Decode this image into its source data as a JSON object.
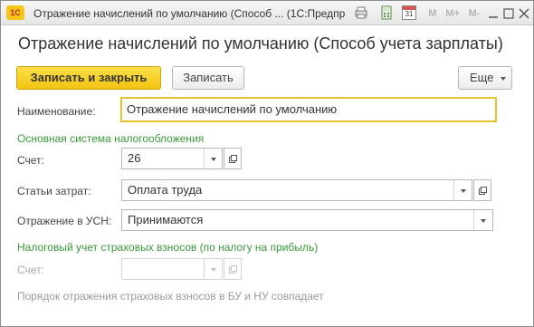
{
  "window": {
    "app_logo_text": "1С",
    "title": "Отражение начислений по умолчанию (Способ ... (1С:Предприятие)",
    "toolbar": {
      "m_label": "M",
      "m_plus_label": "M+",
      "m_minus_label": "M-",
      "calendar_day": "31",
      "icons": [
        "printer-icon",
        "calculator-icon",
        "calendar-icon",
        "minimize-icon",
        "maximize-icon",
        "close-icon"
      ]
    }
  },
  "form": {
    "header": "Отражение начислений по умолчанию (Способ учета зарплаты)",
    "buttons": {
      "save_and_close": "Записать и закрыть",
      "save": "Записать",
      "more": "Еще"
    },
    "name_label": "Наименование:",
    "name_value": "Отражение начислений по умолчанию",
    "main_tax_section": "Основная система налогообложения",
    "account_label": "Счет:",
    "account_value": "26",
    "cost_items_label": "Статьи затрат:",
    "cost_items_value": "Оплата труда",
    "usn_label": "Отражение в УСН:",
    "usn_value": "Принимаются",
    "insurance_section": "Налоговый учет страховых взносов (по налогу на прибыль)",
    "insurance_account_label": "Счет:",
    "insurance_account_value": "",
    "note": "Порядок отражения страховых взносов в БУ и НУ совпадает"
  },
  "colors": {
    "accent_yellow": "#f5c518",
    "section_green": "#3a9a3a",
    "focus_border": "#e9c230"
  }
}
